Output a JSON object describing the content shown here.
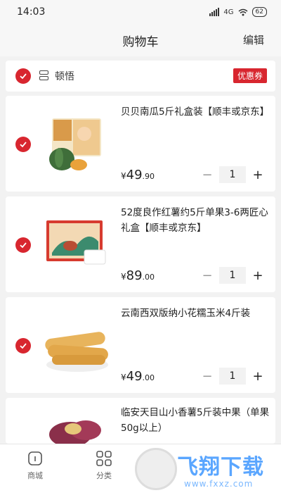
{
  "status_bar": {
    "time": "14:03",
    "network": "4G",
    "battery": "62"
  },
  "nav": {
    "title": "购物车",
    "edit_label": "编辑"
  },
  "store": {
    "name": "顿悟",
    "coupon_label": "优惠券"
  },
  "items": [
    {
      "title": "贝贝南瓜5斤礼盒装【顺丰或京东】",
      "price_currency": "¥",
      "price_int": "49",
      "price_dec": ".90",
      "quantity": "1",
      "checked": true
    },
    {
      "title": "52度良作红薯约5斤单果3-6两匠心礼盒【顺丰或京东】",
      "price_currency": "¥",
      "price_int": "89",
      "price_dec": ".00",
      "quantity": "1",
      "checked": true
    },
    {
      "title": "云南西双版纳小花糯玉米4斤装",
      "price_currency": "¥",
      "price_int": "49",
      "price_dec": ".00",
      "quantity": "1",
      "checked": true
    },
    {
      "title": "临安天目山小香薯5斤装中果（单果50g以上）",
      "checked": true
    }
  ],
  "stepper": {
    "minus": "−",
    "plus": "+"
  },
  "tab_bar": {
    "tabs": [
      {
        "label": "商城",
        "icon": "home-icon"
      },
      {
        "label": "分类",
        "icon": "grid-icon"
      }
    ]
  },
  "watermark": {
    "text": "飞翔下载",
    "url": "www.fxxz.com"
  },
  "colors": {
    "accent": "#d8262f",
    "background": "#f2f2f2"
  }
}
